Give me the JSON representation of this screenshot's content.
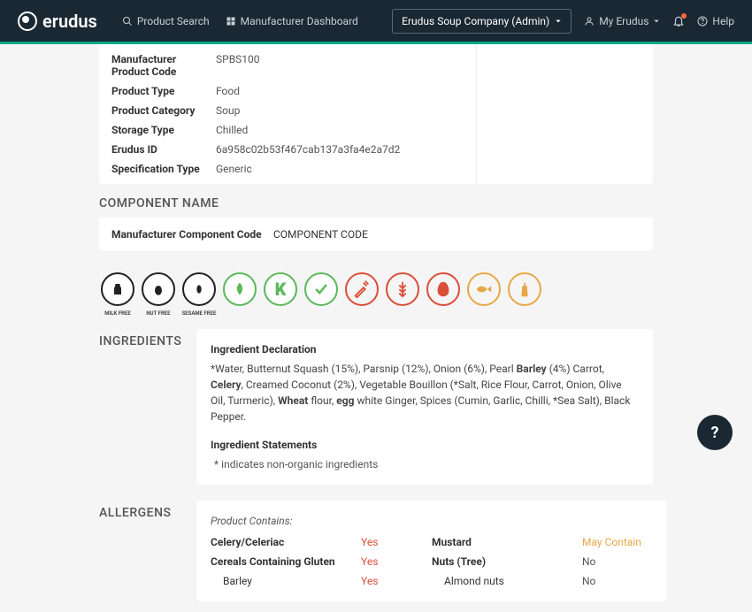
{
  "header": {
    "brand": "erudus",
    "nav": {
      "product_search": "Product Search",
      "manufacturer_dashboard": "Manufacturer Dashboard"
    },
    "company": "Erudus Soup Company (Admin)",
    "my_erudus": "My Erudus",
    "help": "Help"
  },
  "details": {
    "rows": [
      {
        "label": "Manufacturer Product Code",
        "value": "SPBS100"
      },
      {
        "label": "Product Type",
        "value": "Food"
      },
      {
        "label": "Product Category",
        "value": "Soup"
      },
      {
        "label": "Storage Type",
        "value": "Chilled"
      },
      {
        "label": "Erudus ID",
        "value": "6a958c02b53f467cab137a3fa4e2a7d2"
      },
      {
        "label": "Specification Type",
        "value": "Generic"
      }
    ]
  },
  "component_name_title": "COMPONENT NAME",
  "component_code": {
    "label": "Manufacturer Component Code",
    "value": "COMPONENT CODE"
  },
  "badges": {
    "milk_free": "MILK FREE",
    "nut_free": "NUT FREE",
    "sesame_free": "SESAME FREE"
  },
  "ingredients": {
    "title": "INGREDIENTS",
    "decl_heading": "Ingredient Declaration",
    "decl_pre": "*Water, Butternut Squash (15%), Parsnip (12%), Onion (6%), Pearl ",
    "barley": "Barley",
    "decl_mid1": " (4%) Carrot, ",
    "celery": "Celery",
    "decl_mid2": ", Creamed Coconut (2%), Vegetable Bouillon (*Salt, Rice Flour, Carrot, Onion, Olive Oil, Turmeric), ",
    "wheat": "Wheat",
    "decl_mid3": " flour, ",
    "egg": "egg",
    "decl_post": " white Ginger, Spices (Cumin, Garlic, Chilli, *Sea Salt), Black Pepper.",
    "stmt_heading": "Ingredient Statements",
    "stmt_note": "* indicates non-organic ingredients"
  },
  "allergens": {
    "title": "ALLERGENS",
    "contains_label": "Product Contains:",
    "rows": [
      {
        "l_name": "Celery/Celeriac",
        "l_val": "Yes",
        "l_cls": "yes",
        "r_name": "Mustard",
        "r_val": "May Contain",
        "r_cls": "may"
      },
      {
        "l_name": "Cereals Containing Gluten",
        "l_val": "Yes",
        "l_cls": "yes",
        "r_name": "Nuts (Tree)",
        "r_val": "No",
        "r_cls": "no"
      },
      {
        "l_name": "Barley",
        "l_sub": true,
        "l_val": "Yes",
        "l_cls": "yes",
        "r_name": "Almond nuts",
        "r_sub": true,
        "r_val": "No",
        "r_cls": "no"
      }
    ]
  }
}
